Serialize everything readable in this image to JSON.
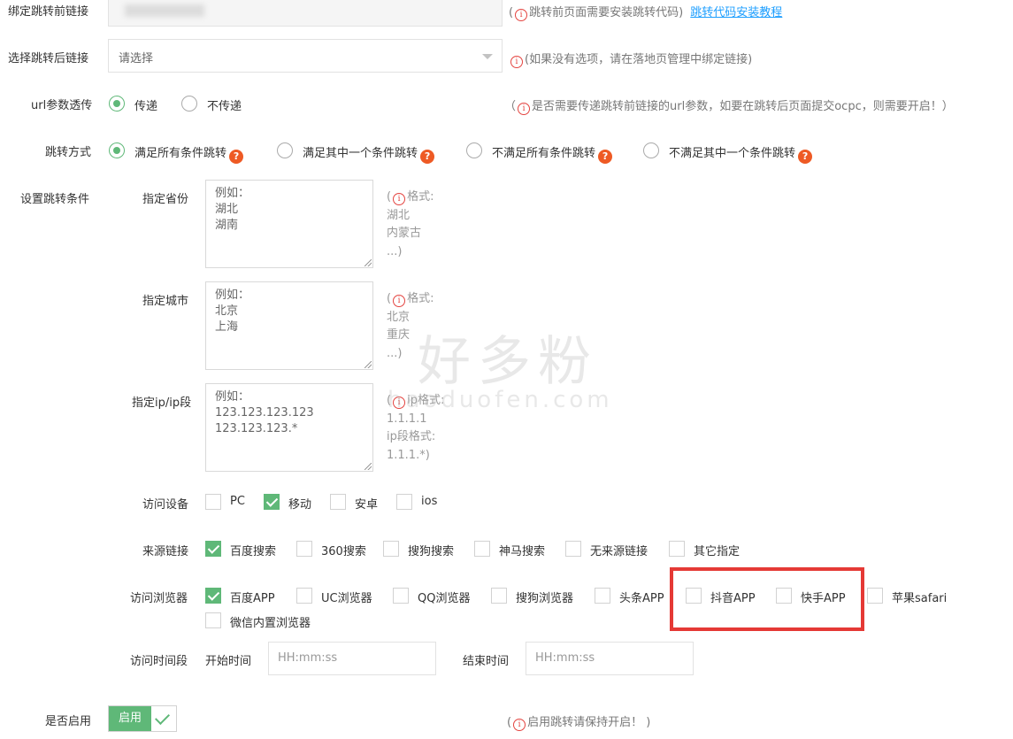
{
  "rows": {
    "bind_link": {
      "label": "绑定跳转前链接",
      "hint": "(",
      "hint_text": "跳转前页面需要安装跳转代码)",
      "link": "跳转代码安装教程"
    },
    "select_link": {
      "label": "选择跳转后链接",
      "placeholder": "请选择",
      "hint": "(",
      "hint_text": "(如果没有选项，请在落地页管理中绑定链接)"
    },
    "url_param": {
      "label": "url参数透传",
      "options": [
        "传递",
        "不传递"
      ],
      "selected": 0,
      "hint_text": "是否需要传递跳转前链接的url参数，如要在跳转后页面提交ocpc，则需要开启！）",
      "hint_open": "（"
    },
    "redirect_mode": {
      "label": "跳转方式",
      "options": [
        "满足所有条件跳转",
        "满足其中一个条件跳转",
        "不满足所有条件跳转",
        "不满足其中一个条件跳转"
      ],
      "selected": 0
    },
    "conditions_label": "设置跳转条件",
    "province": {
      "label": "指定省份",
      "placeholder": "例如：\n湖北\n湖南",
      "format_head": "格式:",
      "format_body": "湖北\n内蒙古\n...)"
    },
    "city": {
      "label": "指定城市",
      "placeholder": "例如：\n北京\n上海",
      "format_head": "格式:",
      "format_body": "北京\n重庆\n...)"
    },
    "ip": {
      "label": "指定ip/ip段",
      "placeholder": "例如：\n123.123.123.123\n123.123.123.*",
      "format_head": "ip格式:",
      "format_body": "1.1.1.1\nip段格式:\n1.1.1.*)"
    },
    "device": {
      "label": "访问设备",
      "options": [
        {
          "label": "PC",
          "checked": false
        },
        {
          "label": "移动",
          "checked": true
        },
        {
          "label": "安卓",
          "checked": false
        },
        {
          "label": "ios",
          "checked": false
        }
      ]
    },
    "source": {
      "label": "来源链接",
      "options": [
        {
          "label": "百度搜索",
          "checked": true
        },
        {
          "label": "360搜索",
          "checked": false
        },
        {
          "label": "搜狗搜索",
          "checked": false
        },
        {
          "label": "神马搜索",
          "checked": false
        },
        {
          "label": "无来源链接",
          "checked": false
        },
        {
          "label": "其它指定",
          "checked": false
        }
      ]
    },
    "browser": {
      "label": "访问浏览器",
      "options": [
        {
          "label": "百度APP",
          "checked": true
        },
        {
          "label": "UC浏览器",
          "checked": false
        },
        {
          "label": "QQ浏览器",
          "checked": false
        },
        {
          "label": "搜狗浏览器",
          "checked": false
        },
        {
          "label": "头条APP",
          "checked": false
        },
        {
          "label": "抖音APP",
          "checked": false
        },
        {
          "label": "快手APP",
          "checked": false
        },
        {
          "label": "苹果safari",
          "checked": false
        },
        {
          "label": "微信内置浏览器",
          "checked": false
        }
      ]
    },
    "time": {
      "label": "访问时间段",
      "start_label": "开始时间",
      "start_placeholder": "HH:mm:ss",
      "end_label": "结束时间",
      "end_placeholder": "HH:mm:ss"
    },
    "enable": {
      "label": "是否启用",
      "switch_label": "启用",
      "hint_open": "(",
      "hint_text": "启用跳转请保持开启！ )"
    }
  },
  "watermark": {
    "big": "好多粉",
    "small": "haoduofen.com"
  },
  "colors": {
    "accent": "#5fb878",
    "info": "#e4433f",
    "highlight": "#e53935",
    "link": "#1e9fff"
  },
  "icons": {
    "info": "info-circle-icon",
    "help": "question-icon",
    "dropdown": "caret-down-icon",
    "check": "check-icon"
  }
}
